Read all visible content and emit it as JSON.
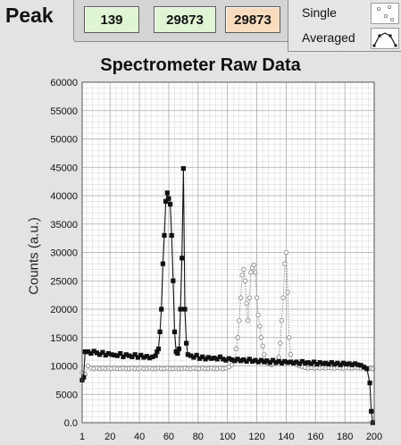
{
  "peak": {
    "label": "Peak",
    "boxes": [
      {
        "value": "139",
        "color": "#dff5d3"
      },
      {
        "value": "29873",
        "color": "#dff5d3"
      },
      {
        "value": "29873",
        "color": "#f8dcbd"
      }
    ]
  },
  "legend": {
    "items": [
      {
        "label": "Single",
        "style": "dashed-open-circle",
        "color": "#8a8a8a"
      },
      {
        "label": "Averaged",
        "style": "solid-filled-square",
        "color": "#111111"
      }
    ]
  },
  "chart_data": {
    "type": "scatter",
    "title": "Spectrometer Raw Data",
    "ylabel": "Counts (a.u.)",
    "xlabel": "",
    "xlim": [
      1,
      200
    ],
    "ylim": [
      0,
      60000
    ],
    "grid": true,
    "legend_position": "top-right",
    "x_ticks": [
      "1",
      "20",
      "40",
      "60",
      "80",
      "100",
      "120",
      "140",
      "160",
      "180",
      "200"
    ],
    "x_tick_values": [
      1,
      20,
      40,
      60,
      80,
      100,
      120,
      140,
      160,
      180,
      200
    ],
    "y_ticks": [
      "0.0",
      "5000",
      "10000",
      "15000",
      "20000",
      "25000",
      "30000",
      "35000",
      "40000",
      "45000",
      "50000",
      "55000",
      "60000"
    ],
    "y_tick_values": [
      0,
      5000,
      10000,
      15000,
      20000,
      25000,
      30000,
      35000,
      40000,
      45000,
      50000,
      55000,
      60000
    ],
    "series": [
      {
        "name": "Averaged",
        "color": "#111111",
        "marker": "filled-square",
        "line": "solid",
        "x": [
          1,
          2,
          3,
          5,
          7,
          9,
          11,
          13,
          15,
          17,
          19,
          21,
          23,
          25,
          27,
          29,
          31,
          33,
          35,
          37,
          39,
          41,
          43,
          45,
          47,
          49,
          51,
          52,
          53,
          54,
          55,
          56,
          57,
          58,
          59,
          60,
          61,
          62,
          63,
          64,
          65,
          66,
          67,
          68,
          69,
          70,
          71,
          72,
          73,
          75,
          77,
          79,
          81,
          83,
          85,
          87,
          89,
          91,
          93,
          95,
          97,
          99,
          101,
          103,
          105,
          107,
          109,
          111,
          113,
          115,
          117,
          119,
          121,
          123,
          125,
          127,
          129,
          131,
          133,
          135,
          137,
          139,
          141,
          143,
          145,
          147,
          149,
          151,
          153,
          155,
          157,
          159,
          161,
          163,
          165,
          167,
          169,
          171,
          173,
          175,
          177,
          179,
          181,
          183,
          185,
          187,
          189,
          191,
          193,
          195,
          197,
          198,
          199
        ],
        "y": [
          7500,
          8000,
          12500,
          12500,
          12200,
          12600,
          12300,
          12000,
          12400,
          11900,
          12200,
          12000,
          11900,
          11800,
          12200,
          11600,
          12000,
          11800,
          11600,
          12000,
          11500,
          11900,
          11500,
          11700,
          11400,
          11600,
          11800,
          12500,
          13000,
          16000,
          20000,
          28000,
          33000,
          39000,
          40500,
          39500,
          38500,
          33000,
          25000,
          16000,
          12500,
          12200,
          13000,
          20000,
          29000,
          44800,
          20000,
          14000,
          12000,
          11800,
          11500,
          11900,
          11300,
          11600,
          11200,
          11500,
          11300,
          11400,
          11200,
          11600,
          11200,
          11000,
          11300,
          11100,
          10900,
          11200,
          10900,
          11100,
          10800,
          11200,
          10800,
          11000,
          10700,
          11000,
          10700,
          10900,
          10600,
          11000,
          10600,
          10800,
          10500,
          10800,
          10600,
          10700,
          10500,
          10700,
          10400,
          10800,
          10500,
          10600,
          10400,
          10700,
          10300,
          10600,
          10400,
          10500,
          10300,
          10600,
          10300,
          10500,
          10200,
          10500,
          10300,
          10400,
          10200,
          10400,
          10200,
          10100,
          9800,
          9500,
          7000,
          2000,
          0
        ]
      },
      {
        "name": "Single",
        "color": "#8a8a8a",
        "marker": "open-circle",
        "line": "dotted",
        "x": [
          1,
          3,
          5,
          7,
          9,
          11,
          13,
          15,
          17,
          19,
          21,
          23,
          25,
          27,
          29,
          31,
          33,
          35,
          37,
          39,
          41,
          43,
          45,
          47,
          49,
          51,
          53,
          55,
          57,
          59,
          61,
          63,
          65,
          67,
          69,
          71,
          73,
          75,
          77,
          79,
          81,
          83,
          85,
          87,
          89,
          91,
          93,
          95,
          97,
          99,
          101,
          103,
          105,
          106,
          107,
          108,
          109,
          110,
          111,
          112,
          113,
          114,
          115,
          116,
          117,
          118,
          119,
          120,
          121,
          122,
          123,
          124,
          125,
          126,
          127,
          128,
          129,
          130,
          131,
          133,
          135,
          136,
          137,
          138,
          139,
          140,
          141,
          142,
          143,
          145,
          147,
          149,
          151,
          153,
          155,
          157,
          159,
          161,
          163,
          165,
          167,
          169,
          171,
          173,
          175,
          177,
          179,
          181,
          183,
          185,
          187,
          189,
          191,
          193,
          195,
          197,
          199
        ],
        "y": [
          8800,
          8500,
          10000,
          9600,
          9500,
          9600,
          9500,
          9600,
          9500,
          9600,
          9500,
          9600,
          9500,
          9500,
          9600,
          9500,
          9500,
          9600,
          9500,
          9500,
          9600,
          9500,
          9500,
          9600,
          9500,
          9500,
          9600,
          9500,
          9500,
          9600,
          9500,
          9500,
          9600,
          9500,
          9500,
          9600,
          9500,
          9500,
          9600,
          9500,
          9500,
          9600,
          9500,
          9500,
          9600,
          9500,
          9500,
          9600,
          9500,
          9600,
          9800,
          10200,
          11000,
          13000,
          15000,
          18000,
          22000,
          26000,
          27000,
          25000,
          21000,
          18000,
          22000,
          26500,
          27300,
          27800,
          26500,
          22000,
          19000,
          17000,
          15000,
          13500,
          12000,
          11000,
          10600,
          10400,
          10300,
          10200,
          10300,
          10500,
          11500,
          14000,
          18000,
          22000,
          28000,
          30000,
          23000,
          15000,
          12000,
          10500,
          10200,
          10000,
          9800,
          9700,
          9600,
          9700,
          9600,
          9700,
          9600,
          9700,
          9600,
          9700,
          9600,
          9600,
          9700,
          9600,
          9600,
          9700,
          9600,
          9600,
          9700,
          9600,
          9600,
          9700,
          9600,
          9600,
          9500
        ]
      }
    ]
  }
}
